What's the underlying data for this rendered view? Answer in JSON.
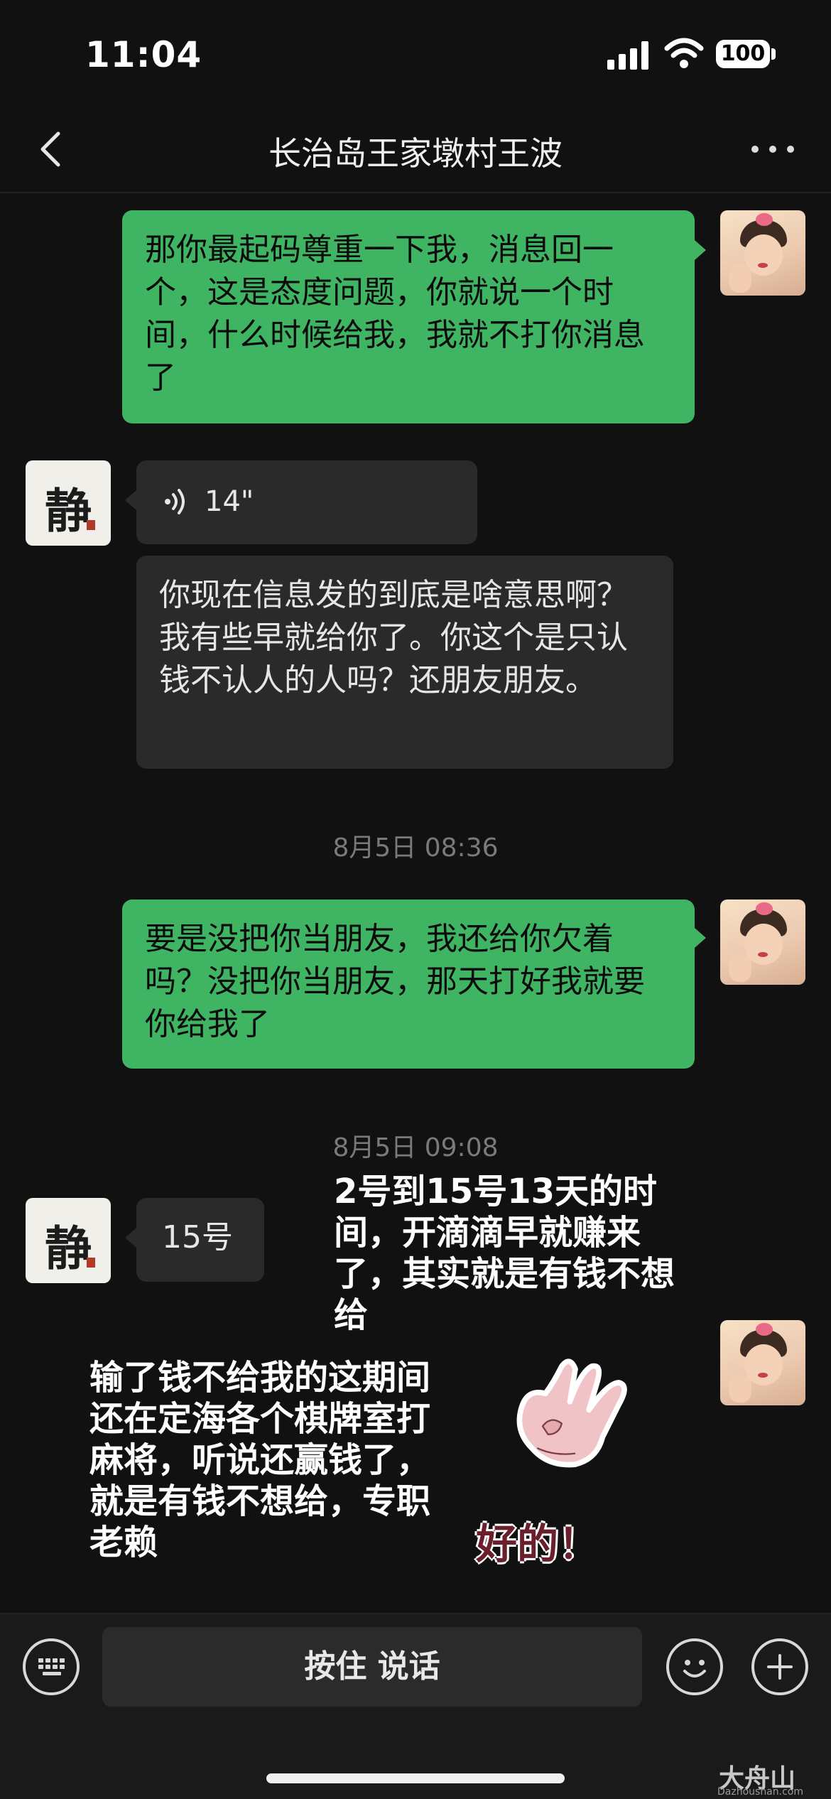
{
  "status_bar": {
    "time": "11:04",
    "battery": "100"
  },
  "header": {
    "title": "长治岛王家墩村王波"
  },
  "messages": {
    "m1": "那你最起码尊重一下我，消息回一个，这是态度问题，你就说一个时间，什么时候给我，我就不打你消息了",
    "voice_duration": "14\"",
    "m2": "你现在信息发的到底是啥意思啊？我有些早就给你了。你这个是只认钱不认人的人吗？还朋友朋友。",
    "ts1": "8月5日 08:36",
    "m3": "要是没把你当朋友，我还给你欠着吗？没把你当朋友，那天打好我就要你给我了",
    "ts2": "8月5日 09:08",
    "m4": "15号"
  },
  "overlays": {
    "note1": "2号到15号13天的时间，开滴滴早就赚来了，其实就是有钱不想给",
    "note2": "输了钱不给我的这期间还在定海各个棋牌室打麻将，听说还赢钱了，就是有钱不想给，专职老赖"
  },
  "sticker": {
    "caption": "好的！"
  },
  "contact_avatar": {
    "char": "静"
  },
  "input": {
    "hold_to_talk": "按住 说话"
  },
  "watermark": {
    "logo": "大舟山",
    "sub": "Dazhoushan.com"
  },
  "colors": {
    "sent_bubble": "#3fb462",
    "received_bubble": "#2a2a2a",
    "background": "#111111"
  }
}
